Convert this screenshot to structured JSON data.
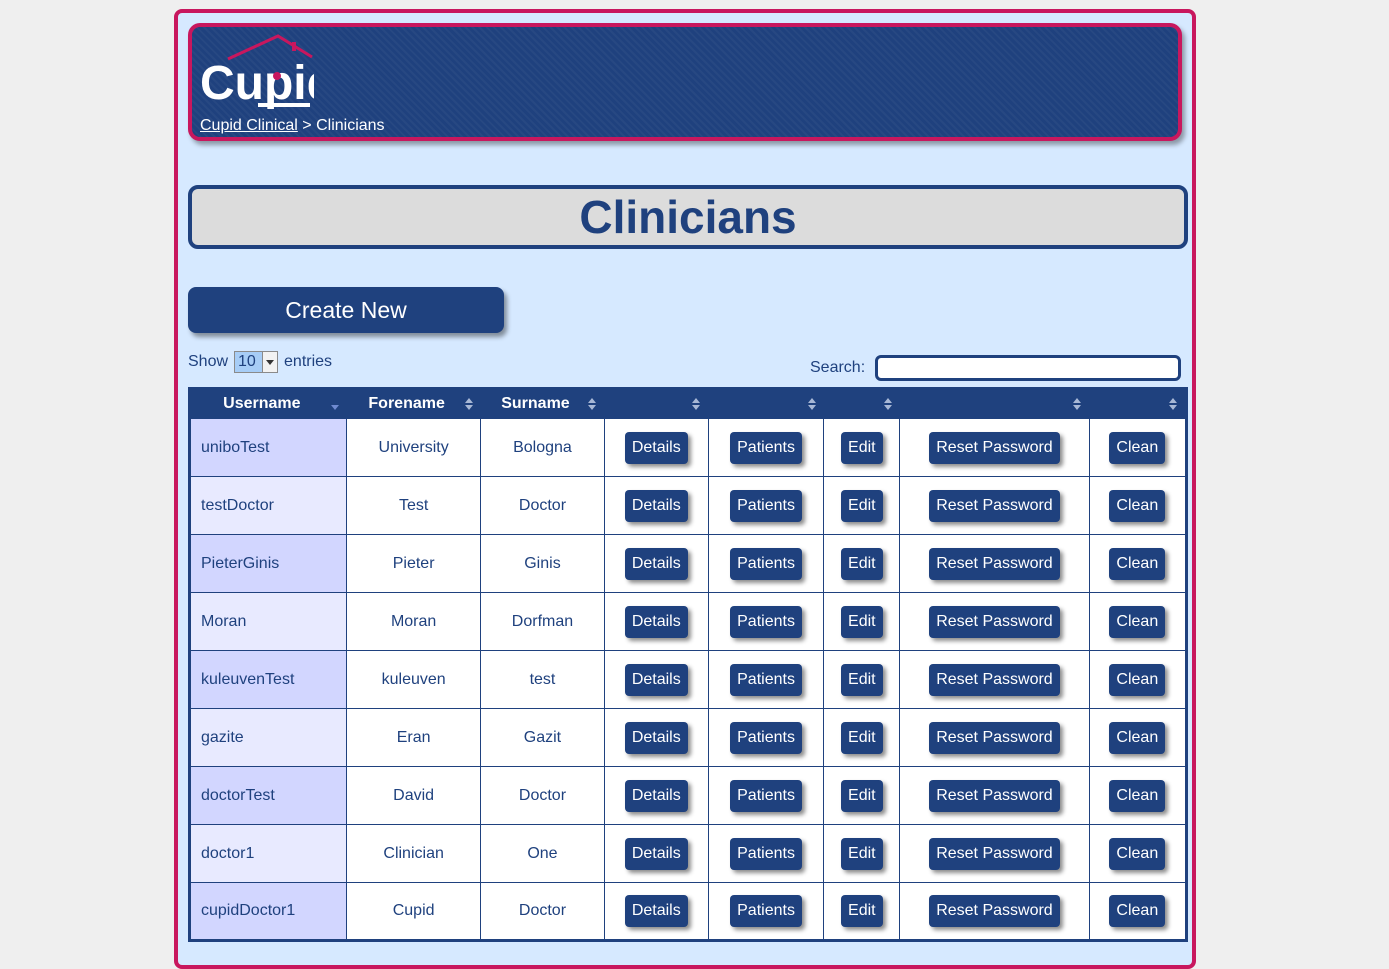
{
  "header": {
    "logo_text": "Cupid",
    "breadcrumb_link": "Cupid Clinical",
    "breadcrumb_separator": ">",
    "breadcrumb_current": "Clinicians"
  },
  "page_title": "Clinicians",
  "create_button": "Create New",
  "length_menu": {
    "show_label": "Show",
    "selected": "10",
    "entries_label": "entries"
  },
  "search": {
    "label": "Search:",
    "value": ""
  },
  "table": {
    "columns": [
      "Username",
      "Forename",
      "Surname",
      "",
      "",
      "",
      "",
      ""
    ],
    "sorted_column": "Username",
    "button_labels": [
      "Details",
      "Patients",
      "Edit",
      "Reset Password",
      "Clean"
    ],
    "rows": [
      {
        "username": "uniboTest",
        "forename": "University",
        "surname": "Bologna"
      },
      {
        "username": "testDoctor",
        "forename": "Test",
        "surname": "Doctor"
      },
      {
        "username": "PieterGinis",
        "forename": "Pieter",
        "surname": "Ginis"
      },
      {
        "username": "Moran",
        "forename": "Moran",
        "surname": "Dorfman"
      },
      {
        "username": "kuleuvenTest",
        "forename": "kuleuven",
        "surname": "test"
      },
      {
        "username": "gazite",
        "forename": "Eran",
        "surname": "Gazit"
      },
      {
        "username": "doctorTest",
        "forename": "David",
        "surname": "Doctor"
      },
      {
        "username": "doctor1",
        "forename": "Clinician",
        "surname": "One"
      },
      {
        "username": "cupidDoctor1",
        "forename": "Cupid",
        "surname": "Doctor"
      }
    ]
  },
  "colors": {
    "navy": "#1f417e",
    "magenta": "#c8175e",
    "page_background": "#d6e9ff",
    "title_background": "#dcdcdc"
  }
}
